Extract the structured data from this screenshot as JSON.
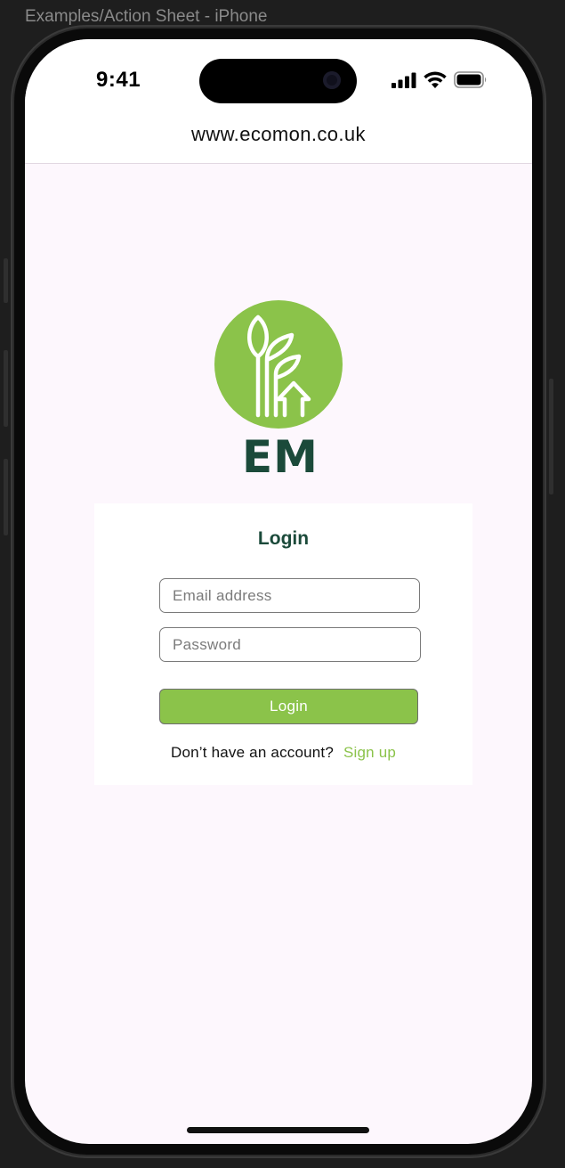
{
  "frame": {
    "title": "Examples/Action Sheet - iPhone"
  },
  "status_bar": {
    "time": "9:41"
  },
  "browser": {
    "url": "www.ecomon.co.uk"
  },
  "logo": {
    "text": "EM",
    "brand_green": "#8bc34a",
    "brand_dark": "#1b4a3a"
  },
  "login_card": {
    "title": "Login",
    "email_placeholder": "Email address",
    "email_value": "",
    "password_placeholder": "Password",
    "password_value": "",
    "login_button": "Login",
    "signup_prompt": "Don’t have an account?",
    "signup_link": "Sign up"
  },
  "icons": [
    "signal-icon",
    "wifi-icon",
    "battery-icon",
    "leaf-house-logo-icon"
  ]
}
